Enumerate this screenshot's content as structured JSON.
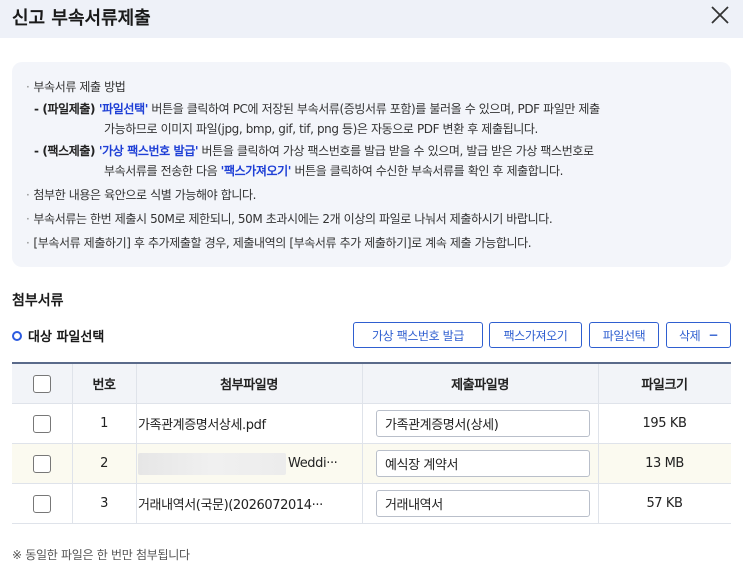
{
  "dialog": {
    "title": "신고 부속서류제출"
  },
  "notice": {
    "heading": "부속서류 제출 방법",
    "file_submit": {
      "prefix": "- (파일제출) ",
      "quote_open": "'",
      "button_name": "파일선택",
      "quote_close": "'",
      "text1": " 버튼을 클릭하여 PC에 저장된 부속서류(증빙서류 포함)를 불러올 수 있으며, PDF 파일만 제출",
      "text2": "가능하므로 이미지 파일(jpg, bmp, gif, tif, png 등)은 자동으로 PDF 변환 후 제출됩니다."
    },
    "fax_submit": {
      "prefix": "- (팩스제출) ",
      "quote_open": "'",
      "button_name": "가상 팩스번호 발급",
      "quote_close": "'",
      "text1": " 버튼을 클릭하여 가상 팩스번호를 발급 받을 수 있으며, 발급 받은 가상 팩스번호로",
      "text2a": "부속서류를 전송한 다음 ",
      "button_name2": "팩스가져오기",
      "text2b": " 버튼을 클릭하여 수신한 부속서류를 확인 후 제출합니다."
    },
    "line_identifiable": "첨부한 내용은 육안으로 식별 가능해야 합니다.",
    "line_limit": "부속서류는 한번 제출시 50M로 제한되니, 50M 초과시에는 2개 이상의 파일로 나눠서 제출하시기 바랍니다.",
    "line_additional": "[부속서류 제출하기] 후 추가제출할 경우, 제출내역의 [부속서류 추가 제출하기]로 계속 제출 가능합니다."
  },
  "attachments": {
    "section_title": "첨부서류",
    "subtitle": "대상 파일선택",
    "buttons": {
      "virtual_fax": "가상 팩스번호 발급",
      "fetch_fax": "팩스가져오기",
      "select_file": "파일선택",
      "delete": "삭제",
      "delete_symbol": "−"
    },
    "columns": {
      "number": "번호",
      "attached_file": "첨부파일명",
      "submit_file": "제출파일명",
      "file_size": "파일크기"
    },
    "rows": [
      {
        "number": "1",
        "attached_file": "가족관계증명서상세.pdf",
        "submit_name": "가족관계증명서(상세)",
        "size": "195 KB"
      },
      {
        "number": "2",
        "attached_file": "Weddi···",
        "submit_name": "예식장 계약서",
        "size": "13 MB"
      },
      {
        "number": "3",
        "attached_file": "거래내역서(국문)(2026072014···",
        "submit_name": "거래내역서",
        "size": "57 KB"
      }
    ],
    "footnote": "※ 동일한 파일은 한 번만 첨부됩니다"
  }
}
